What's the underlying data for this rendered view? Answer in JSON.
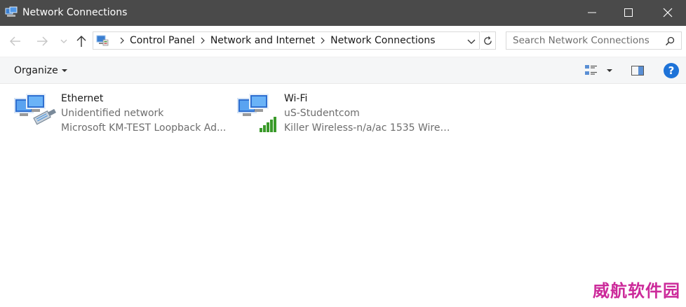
{
  "window": {
    "title": "Network Connections",
    "controls": [
      "minimize-icon",
      "maximize-icon",
      "close-icon"
    ]
  },
  "nav": {
    "breadcrumb": [
      "Control Panel",
      "Network and Internet",
      "Network Connections"
    ]
  },
  "search": {
    "placeholder": "Search Network Connections"
  },
  "toolbar": {
    "organize_label": "Organize",
    "help_label": "?"
  },
  "connections": [
    {
      "name": "Ethernet",
      "status": "Unidentified network",
      "device": "Microsoft KM-TEST Loopback Ad...",
      "icon": "ethernet-adapter-icon"
    },
    {
      "name": "Wi-Fi",
      "status": "uS-Studentcom",
      "device": "Killer Wireless-n/a/ac 1535 Wirele...",
      "icon": "wifi-adapter-icon"
    }
  ],
  "watermark": "威航软件园",
  "colors": {
    "titlebar": "#4a4a4a",
    "accent": "#1e73d8",
    "signal": "#3a9a2a",
    "watermark": "#cc2a9a"
  }
}
